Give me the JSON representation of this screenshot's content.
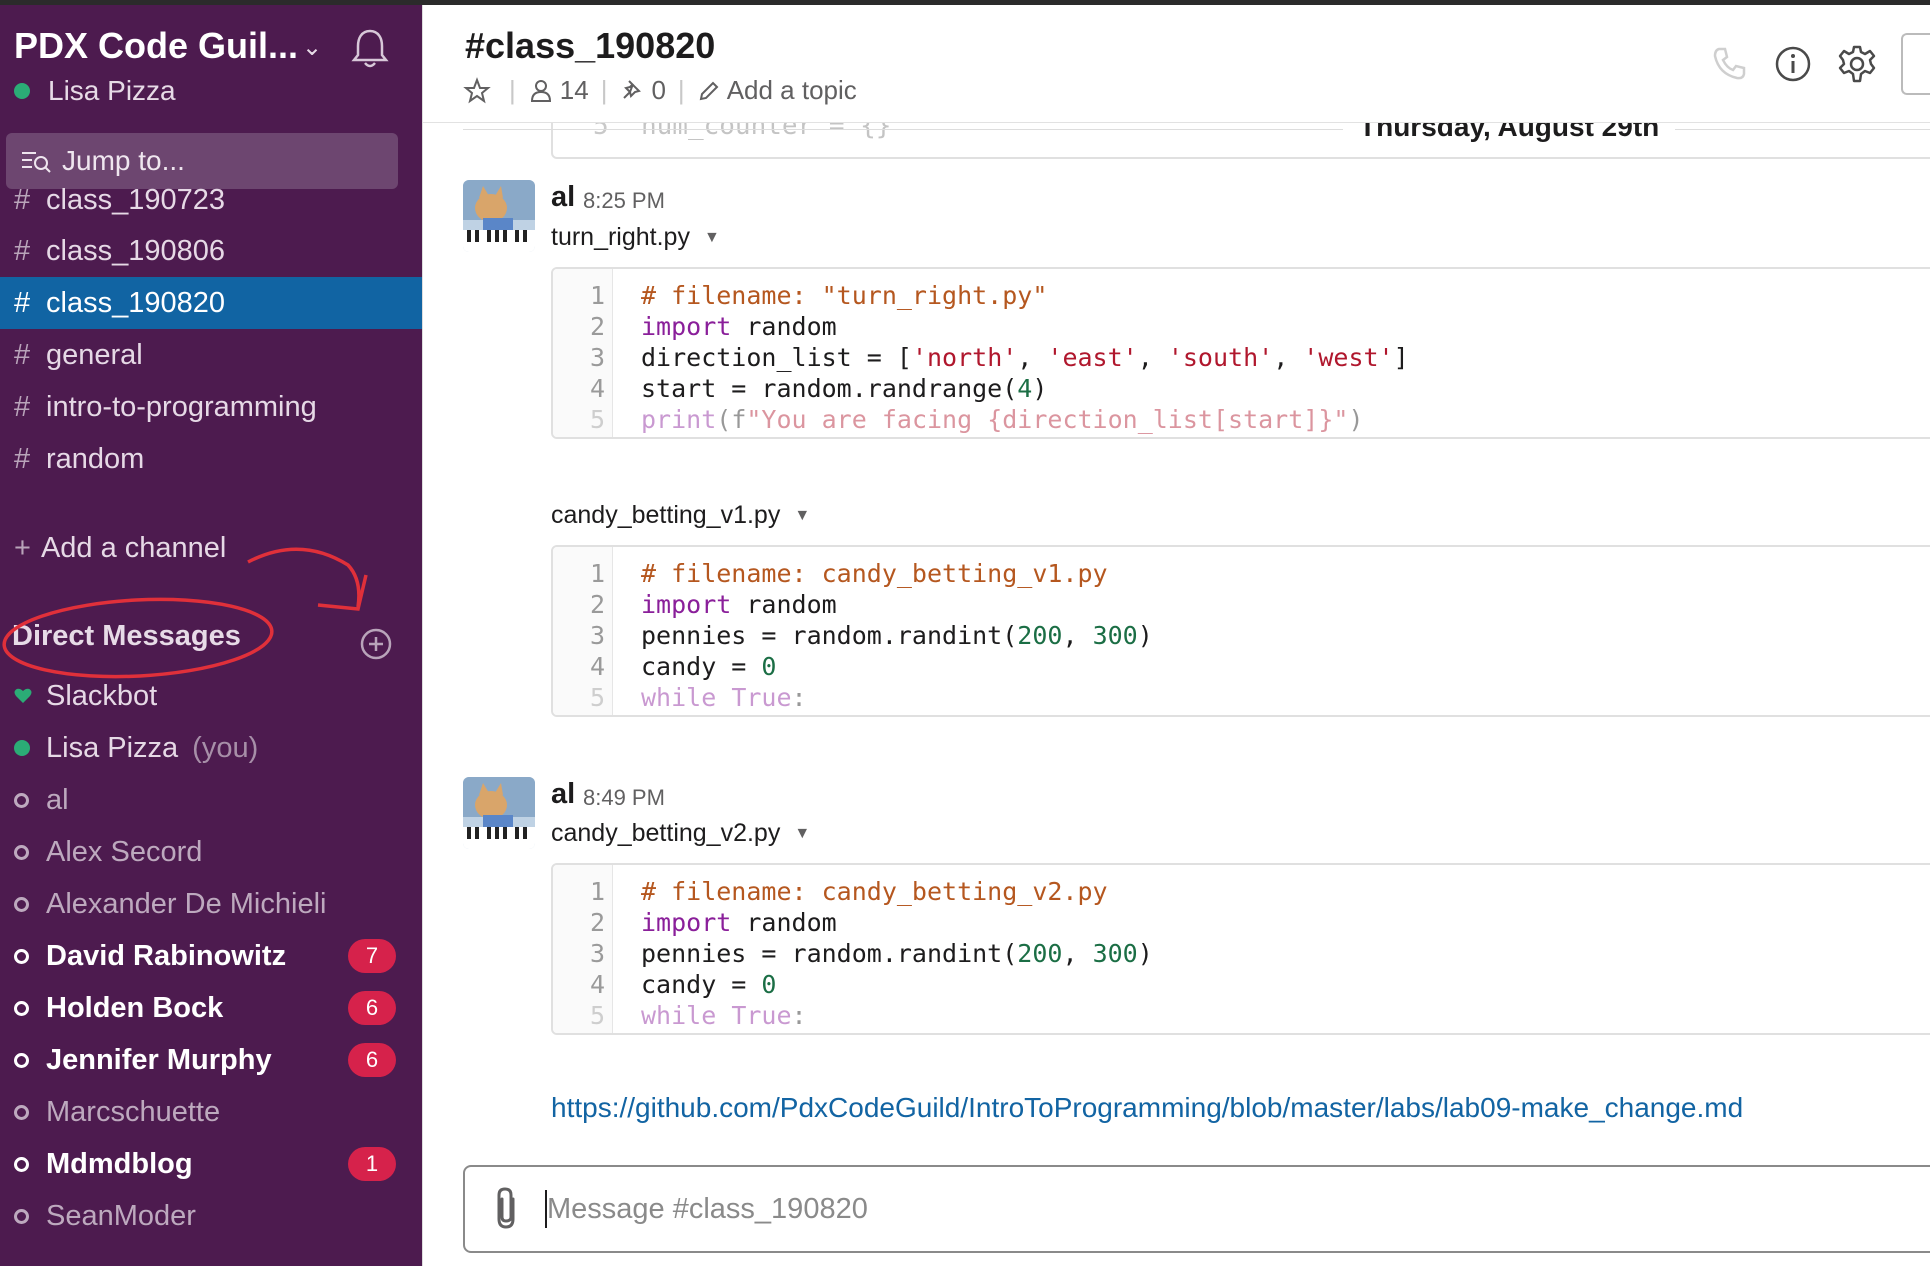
{
  "sidebar": {
    "team_name": "PDX Code Guil...",
    "current_user": "Lisa Pizza",
    "jump_placeholder": "Jump to...",
    "partial_channel": "class_190723",
    "channels": [
      {
        "name": "class_190806"
      },
      {
        "name": "class_190820",
        "active": true
      },
      {
        "name": "general"
      },
      {
        "name": "intro-to-programming"
      },
      {
        "name": "random"
      }
    ],
    "add_channel_label": "Add a channel",
    "dm_header": "Direct Messages",
    "direct_messages": [
      {
        "name": "Slackbot",
        "status": "heart-icon"
      },
      {
        "name": "Lisa Pizza",
        "suffix": "(you)",
        "status": "online"
      },
      {
        "name": "al",
        "status": "away"
      },
      {
        "name": "Alex Secord",
        "status": "away"
      },
      {
        "name": "Alexander De Michieli",
        "status": "away"
      },
      {
        "name": "David Rabinowitz",
        "status": "away",
        "unread": 7
      },
      {
        "name": "Holden Bock",
        "status": "away",
        "unread": 6
      },
      {
        "name": "Jennifer Murphy",
        "status": "away",
        "unread": 6
      },
      {
        "name": "Marcschuette",
        "status": "away"
      },
      {
        "name": "Mdmdblog",
        "status": "away",
        "unread": 1
      },
      {
        "name": "SeanModer",
        "status": "away"
      }
    ],
    "colors": {
      "background": "#4d1b4f",
      "active": "#1164a3",
      "badge": "#d6224b",
      "online": "#2bac76",
      "annotation": "#e0303a"
    }
  },
  "header": {
    "channel_title": "#class_190820",
    "members": "14",
    "pins": "0",
    "topic_label": "Add a topic",
    "icons": [
      "star-icon",
      "person-icon",
      "pin-icon",
      "pencil-icon",
      "phone-icon",
      "info-icon",
      "gear-icon"
    ]
  },
  "day_divider": "Thursday, August 29th",
  "top_snippet": {
    "line_no": "5",
    "code": "num_counter = {}"
  },
  "messages": [
    {
      "author": "al",
      "time": "8:25 PM",
      "snippets": [
        {
          "filename": "turn_right.py",
          "lines": [
            "1",
            "2",
            "3",
            "4",
            "5"
          ]
        },
        {
          "filename": "candy_betting_v1.py",
          "lines": [
            "1",
            "2",
            "3",
            "4",
            "5"
          ]
        }
      ]
    },
    {
      "author": "al",
      "time": "8:49 PM",
      "snippets": [
        {
          "filename": "candy_betting_v2.py",
          "lines": [
            "1",
            "2",
            "3",
            "4",
            "5"
          ]
        }
      ],
      "link": "https://github.com/PdxCodeGuild/IntroToProgramming/blob/master/labs/lab09-make_change.md"
    }
  ],
  "code": {
    "turn_right": {
      "l1": "# filename: \"turn_right.py\"",
      "l2_kw": "import",
      "l2_rest": " random",
      "l3_a": "direction_list = [",
      "l3_s1": "'north'",
      "l3_c1": ", ",
      "l3_s2": "'east'",
      "l3_c2": ", ",
      "l3_s3": "'south'",
      "l3_c3": ", ",
      "l3_s4": "'west'",
      "l3_end": "]",
      "l4_a": "start = random.randrange(",
      "l4_n": "4",
      "l4_end": ")",
      "l5_kw": "print",
      "l5_a": "(f",
      "l5_s": "\"You are facing {direction_list[start]}\"",
      "l5_end": ")"
    },
    "candy_v1": {
      "l1": "# filename: candy_betting_v1.py",
      "l2_kw": "import",
      "l2_rest": " random",
      "l3_a": "pennies = random.randint(",
      "l3_n1": "200",
      "l3_c": ", ",
      "l3_n2": "300",
      "l3_end": ")",
      "l4_a": "candy = ",
      "l4_n": "0",
      "l5_kw": "while",
      "l5_sp": " ",
      "l5_kw2": "True",
      "l5_end": ":"
    },
    "candy_v2": {
      "l1": "# filename: candy_betting_v2.py",
      "l2_kw": "import",
      "l2_rest": " random",
      "l3_a": "pennies = random.randint(",
      "l3_n1": "200",
      "l3_c": ", ",
      "l3_n2": "300",
      "l3_end": ")",
      "l4_a": "candy = ",
      "l4_n": "0",
      "l5_kw": "while",
      "l5_sp": " ",
      "l5_kw2": "True",
      "l5_end": ":"
    }
  },
  "composer": {
    "placeholder": "Message #class_190820"
  }
}
